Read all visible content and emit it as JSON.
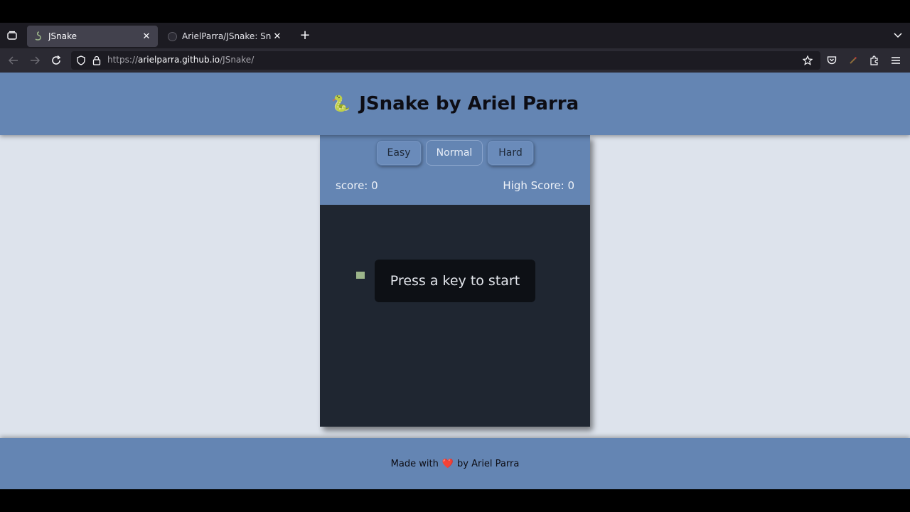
{
  "browser": {
    "tabs": [
      {
        "title": "JSnake",
        "active": true
      },
      {
        "title": "ArielParra/JSnake: Snake g",
        "active": false
      }
    ],
    "url": {
      "prefix": "https://",
      "host": "arielparra.github.io",
      "path": "/JSnake/"
    },
    "icons": {
      "tab_overview": "tab-overview-icon",
      "back": "back-arrow-icon",
      "forward": "forward-arrow-icon",
      "reload": "reload-icon",
      "tracking": "shield-icon",
      "lock": "lock-icon",
      "bookmark": "star-icon",
      "pocket": "pocket-icon",
      "extensions": "puzzle-icon",
      "menu": "hamburger-menu-icon"
    }
  },
  "page": {
    "title_emoji": "🐍",
    "title": "JSnake by Ariel Parra",
    "difficulty": [
      "Easy",
      "Normal",
      "Hard"
    ],
    "score_label": "score: 0",
    "high_score_label": "High Score: 0",
    "start_message": "Press a key to start",
    "footer": {
      "prefix": "Made with",
      "heart": "❤️",
      "suffix": "by Ariel Parra"
    },
    "colors": {
      "header": "#6485b3",
      "board": "#1f2631",
      "snake": "#9cb58a",
      "food": "#5a1f24",
      "page_background": "#dde3ec"
    }
  }
}
